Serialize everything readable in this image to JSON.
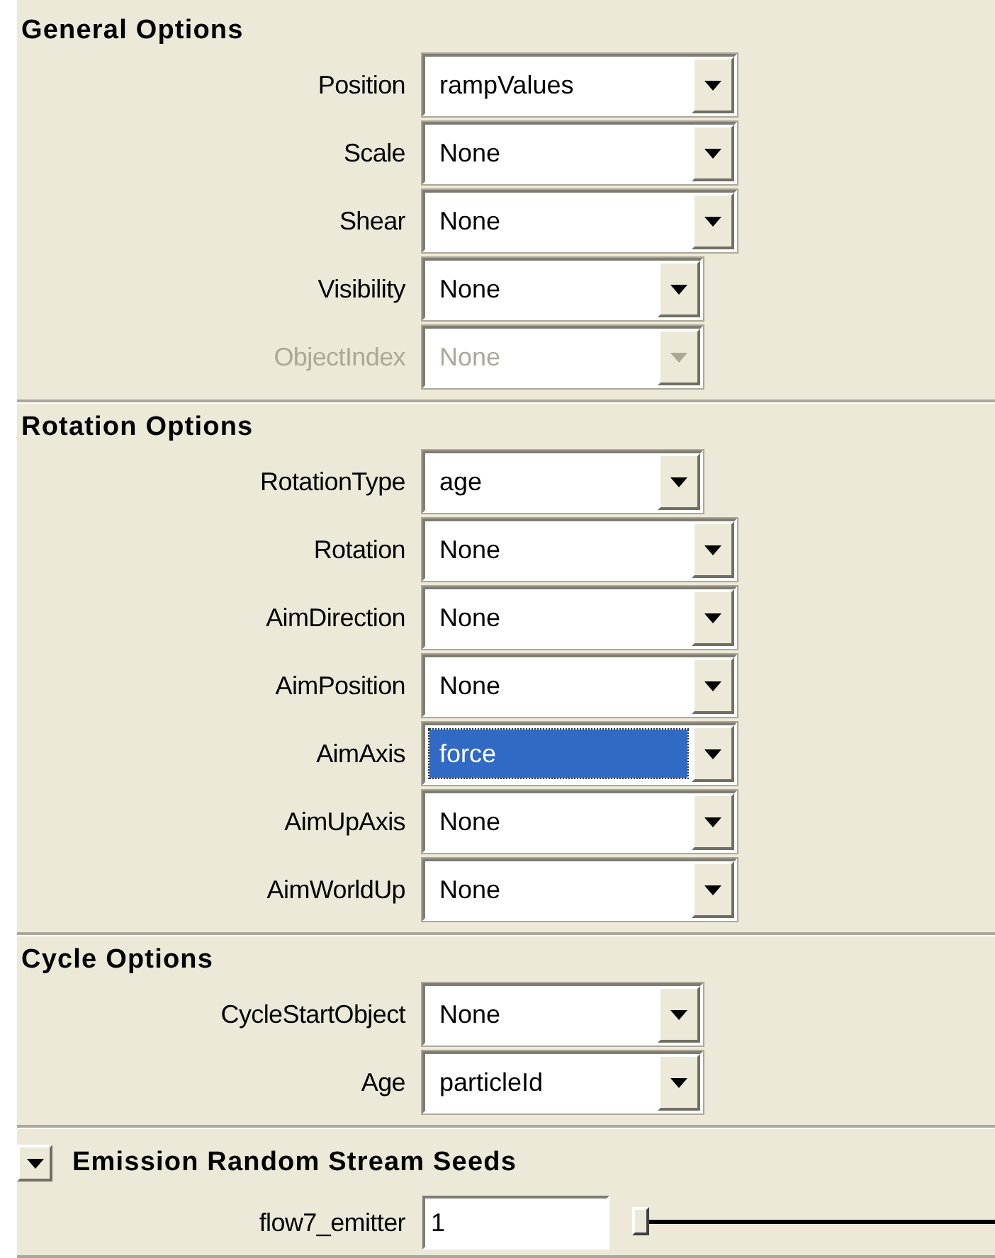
{
  "sections": [
    {
      "title": "General Options",
      "rows": [
        {
          "label": "Position",
          "value": "rampValues",
          "disabled": false,
          "focused": false
        },
        {
          "label": "Scale",
          "value": "None",
          "disabled": false,
          "focused": false
        },
        {
          "label": "Shear",
          "value": "None",
          "disabled": false,
          "focused": false
        },
        {
          "label": "Visibility",
          "value": "None",
          "disabled": false,
          "focused": false
        },
        {
          "label": "ObjectIndex",
          "value": "None",
          "disabled": true,
          "focused": false
        }
      ]
    },
    {
      "title": "Rotation Options",
      "rows": [
        {
          "label": "RotationType",
          "value": "age",
          "disabled": false,
          "focused": false
        },
        {
          "label": "Rotation",
          "value": "None",
          "disabled": false,
          "focused": false
        },
        {
          "label": "AimDirection",
          "value": "None",
          "disabled": false,
          "focused": false
        },
        {
          "label": "AimPosition",
          "value": "None",
          "disabled": false,
          "focused": false
        },
        {
          "label": "AimAxis",
          "value": "force",
          "disabled": false,
          "focused": true
        },
        {
          "label": "AimUpAxis",
          "value": "None",
          "disabled": false,
          "focused": false
        },
        {
          "label": "AimWorldUp",
          "value": "None",
          "disabled": false,
          "focused": false
        }
      ]
    },
    {
      "title": "Cycle Options",
      "rows": [
        {
          "label": "CycleStartObject",
          "value": "None",
          "disabled": false,
          "focused": false
        },
        {
          "label": "Age",
          "value": "particleId",
          "disabled": false,
          "focused": false
        }
      ]
    }
  ],
  "seeds": {
    "title": "Emission Random Stream Seeds",
    "expanded": true,
    "rows": [
      {
        "label": "flow7_emitter",
        "value": "1",
        "level": 0
      }
    ]
  }
}
